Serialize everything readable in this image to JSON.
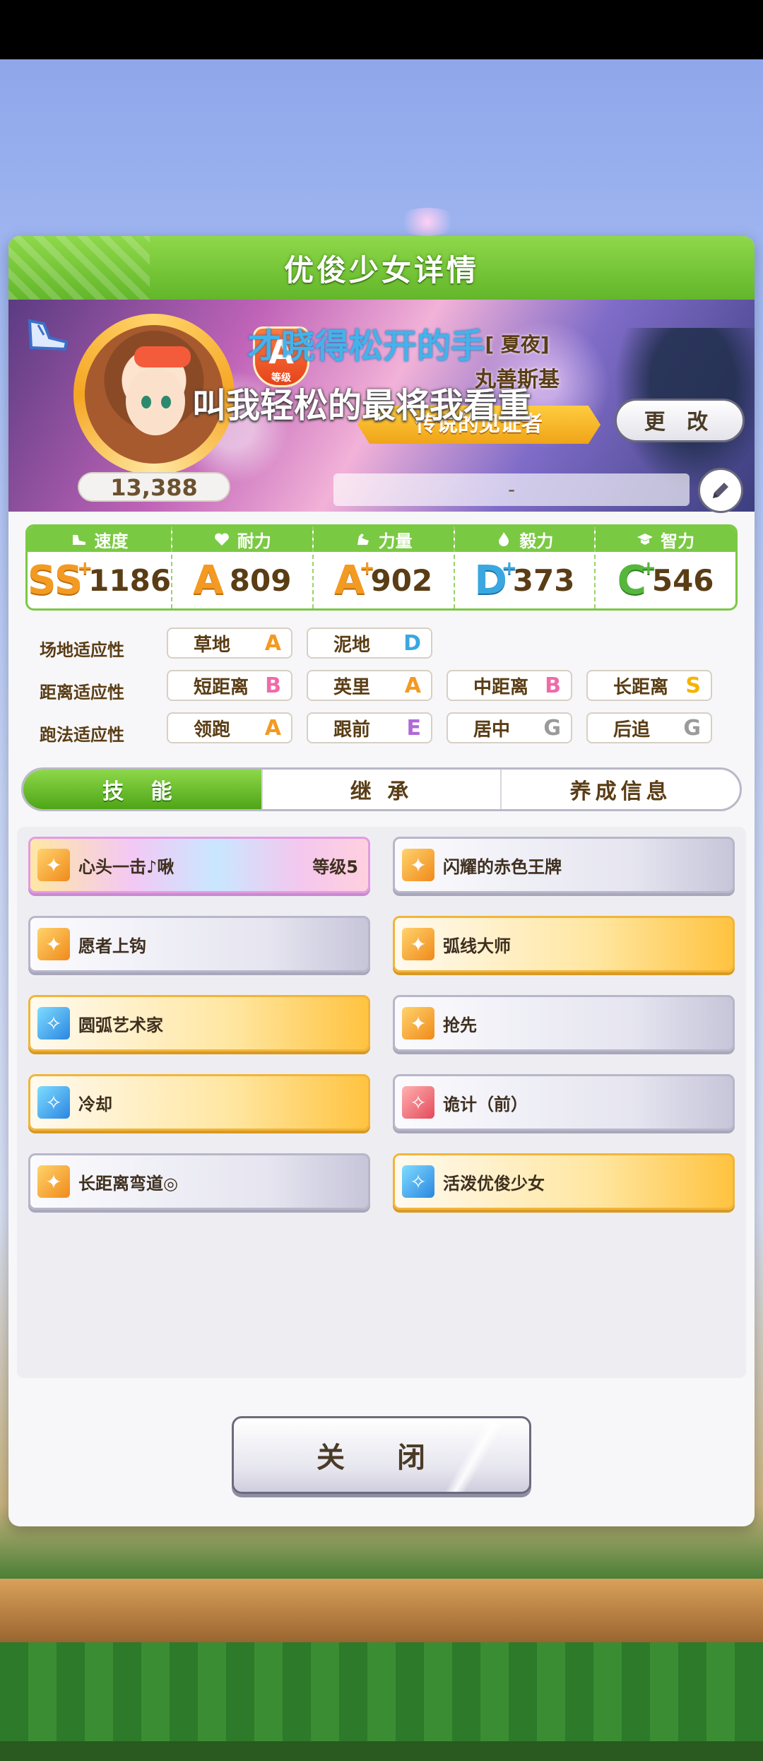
{
  "dialog": {
    "title": "优俊少女详情"
  },
  "profile": {
    "card_title": "[ 夏夜]",
    "name": "丸善斯基",
    "rank_letter": "A",
    "rank_sub": "等级",
    "achievement": "传说的见证者",
    "fans": "13,388",
    "comment": "-",
    "change_label": "更 改"
  },
  "lyrics": {
    "line1": "才晓得松开的手",
    "line2": "叫我轻松的最将我看重"
  },
  "stats": [
    {
      "label": "速度",
      "grade": "SS",
      "plus": "+",
      "value": "1186",
      "icon": "shoe-icon"
    },
    {
      "label": "耐力",
      "grade": "A",
      "plus": "",
      "value": "809",
      "icon": "heart-icon"
    },
    {
      "label": "力量",
      "grade": "A",
      "plus": "+",
      "value": "902",
      "icon": "muscle-icon"
    },
    {
      "label": "毅力",
      "grade": "D",
      "plus": "+",
      "value": "373",
      "icon": "flame-icon"
    },
    {
      "label": "智力",
      "grade": "C",
      "plus": "+",
      "value": "546",
      "icon": "graduation-cap-icon"
    }
  ],
  "aptitude": {
    "track_label": "场地适应性",
    "distance_label": "距离适应性",
    "style_label": "跑法适应性",
    "track": [
      {
        "name": "草地",
        "grade": "A"
      },
      {
        "name": "泥地",
        "grade": "D"
      }
    ],
    "distance": [
      {
        "name": "短距离",
        "grade": "B"
      },
      {
        "name": "英里",
        "grade": "A"
      },
      {
        "name": "中距离",
        "grade": "B"
      },
      {
        "name": "长距离",
        "grade": "S"
      }
    ],
    "style": [
      {
        "name": "领跑",
        "grade": "A"
      },
      {
        "name": "跟前",
        "grade": "E"
      },
      {
        "name": "居中",
        "grade": "G"
      },
      {
        "name": "后追",
        "grade": "G"
      }
    ]
  },
  "tabs": [
    {
      "label": "技 能"
    },
    {
      "label": "继 承"
    },
    {
      "label": "养成信息"
    }
  ],
  "skills": [
    {
      "name": "心头一击♪啾",
      "level": "等级5",
      "style": "rainbow",
      "icon": "orange"
    },
    {
      "name": "闪耀的赤色王牌",
      "level": "",
      "style": "silver",
      "icon": "orange"
    },
    {
      "name": "愿者上钩",
      "level": "",
      "style": "silver",
      "icon": "orange"
    },
    {
      "name": "弧线大师",
      "level": "",
      "style": "gold",
      "icon": "orange"
    },
    {
      "name": "圆弧艺术家",
      "level": "",
      "style": "gold",
      "icon": "blue"
    },
    {
      "name": "抢先",
      "level": "",
      "style": "silver",
      "icon": "orange"
    },
    {
      "name": "冷却",
      "level": "",
      "style": "gold",
      "icon": "blue"
    },
    {
      "name": "诡计（前）",
      "level": "",
      "style": "silver",
      "icon": "red"
    },
    {
      "name": "长距离弯道◎",
      "level": "",
      "style": "silver",
      "icon": "orange"
    },
    {
      "name": "活泼优俊少女",
      "level": "",
      "style": "gold",
      "icon": "blue"
    }
  ],
  "close_label": "关 闭"
}
